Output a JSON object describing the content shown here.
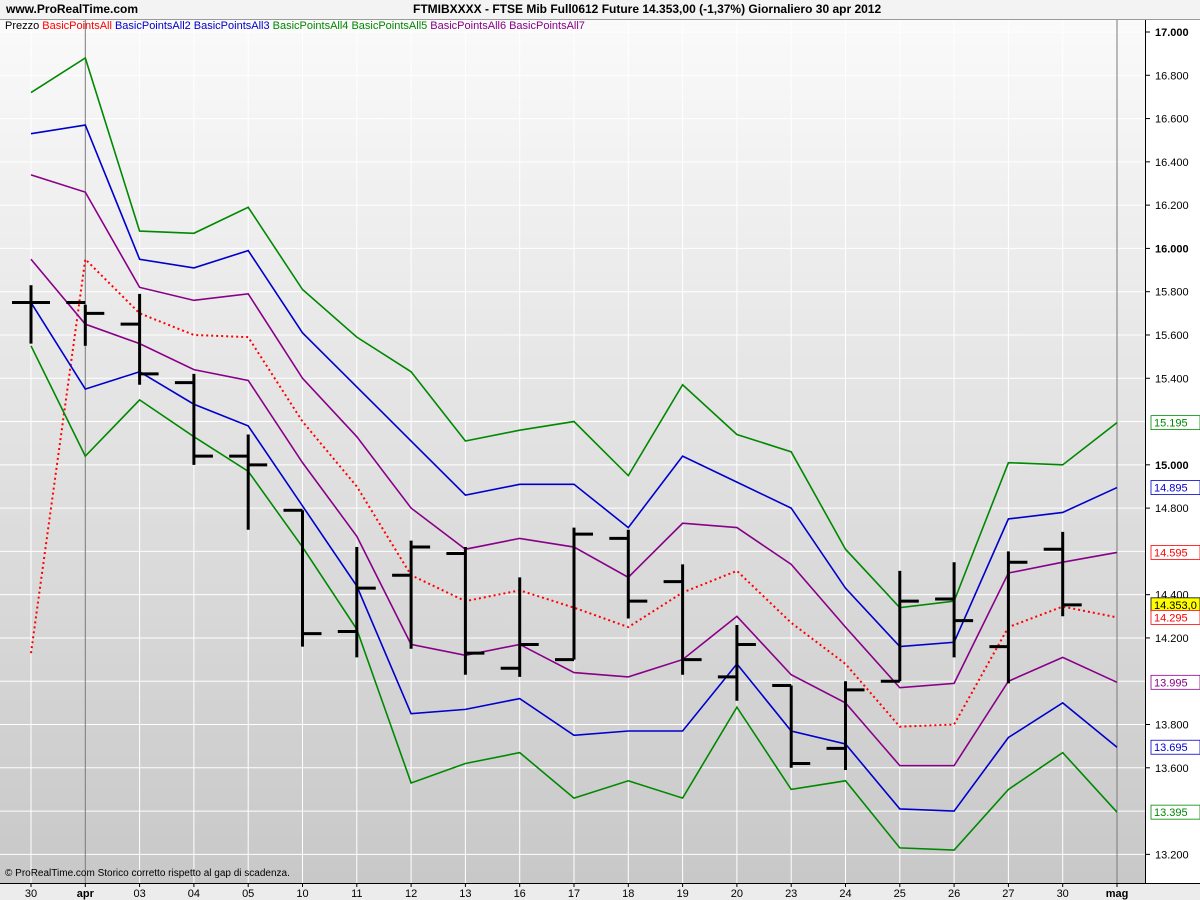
{
  "header": {
    "site": "www.ProRealTime.com",
    "title": "FTMIBXXXX - FTSE Mib Full0612 Future    14.353,00 (-1,37%)    Giornaliero  30 apr 2012"
  },
  "legend": [
    {
      "label": "Prezzo",
      "color": "#000000"
    },
    {
      "label": "BasicPointsAll",
      "color": "#ff0000"
    },
    {
      "label": "BasicPointsAll2",
      "color": "#0000cc"
    },
    {
      "label": "BasicPointsAll3",
      "color": "#0000cc"
    },
    {
      "label": "BasicPointsAll4",
      "color": "#008800"
    },
    {
      "label": "BasicPointsAll5",
      "color": "#008800"
    },
    {
      "label": "BasicPointsAll6",
      "color": "#880088"
    },
    {
      "label": "BasicPointsAll7",
      "color": "#880088"
    }
  ],
  "footer": "© ProRealTime.com  Storico corretto rispetto al gap di scadenza.",
  "chart_data": {
    "type": "line",
    "categories": [
      "30",
      "apr",
      "03",
      "04",
      "05",
      "10",
      "11",
      "12",
      "13",
      "16",
      "17",
      "18",
      "19",
      "20",
      "23",
      "24",
      "25",
      "26",
      "27",
      "30",
      "mag"
    ],
    "ylim": [
      13100,
      17000
    ],
    "yticks": [
      {
        "v": 17000,
        "label": "17.000",
        "bold": true
      },
      {
        "v": 16800,
        "label": "16.800",
        "bold": false
      },
      {
        "v": 16600,
        "label": "16.600",
        "bold": false
      },
      {
        "v": 16400,
        "label": "16.400",
        "bold": false
      },
      {
        "v": 16200,
        "label": "16.200",
        "bold": false
      },
      {
        "v": 16000,
        "label": "16.000",
        "bold": true
      },
      {
        "v": 15800,
        "label": "15.800",
        "bold": false
      },
      {
        "v": 15600,
        "label": "15.600",
        "bold": false
      },
      {
        "v": 15400,
        "label": "15.400",
        "bold": false
      },
      {
        "v": 15000,
        "label": "15.000",
        "bold": true
      },
      {
        "v": 14800,
        "label": "14.800",
        "bold": false
      },
      {
        "v": 14400,
        "label": "14.400",
        "bold": false
      },
      {
        "v": 14200,
        "label": "14.200",
        "bold": false
      },
      {
        "v": 13800,
        "label": "13.800",
        "bold": false
      },
      {
        "v": 13600,
        "label": "13.600",
        "bold": false
      },
      {
        "v": 13200,
        "label": "13.200",
        "bold": false
      }
    ],
    "value_labels": [
      {
        "v": 15195,
        "label": "15.195",
        "color": "#008800",
        "bg": "#ffffff"
      },
      {
        "v": 14895,
        "label": "14.895",
        "color": "#0000cc",
        "bg": "#ffffff"
      },
      {
        "v": 14595,
        "label": "14.595",
        "color": "#ff0000",
        "bg": "#ffffff"
      },
      {
        "v": 14353,
        "label": "14.353,0",
        "color": "#000000",
        "bg": "#ffff00"
      },
      {
        "v": 14295,
        "label": "14.295",
        "color": "#ff0000",
        "bg": "#ffffff"
      },
      {
        "v": 13995,
        "label": "13.995",
        "color": "#880088",
        "bg": "#ffffff"
      },
      {
        "v": 13695,
        "label": "13.695",
        "color": "#0000cc",
        "bg": "#ffffff"
      },
      {
        "v": 13395,
        "label": "13.395",
        "color": "#008800",
        "bg": "#ffffff"
      }
    ],
    "ohlc": [
      {
        "x": "30",
        "open": 15750,
        "high": 15830,
        "low": 15560,
        "close": 15750
      },
      {
        "x": "apr",
        "open": 15750,
        "high": 15740,
        "low": 15550,
        "close": 15700
      },
      {
        "x": "03",
        "open": 15650,
        "high": 15790,
        "low": 15370,
        "close": 15420
      },
      {
        "x": "04",
        "open": 15380,
        "high": 15420,
        "low": 15000,
        "close": 15040
      },
      {
        "x": "05",
        "open": 15040,
        "high": 15140,
        "low": 14700,
        "close": 15000
      },
      {
        "x": "10",
        "open": 14790,
        "high": 14790,
        "low": 14160,
        "close": 14220
      },
      {
        "x": "11",
        "open": 14230,
        "high": 14620,
        "low": 14110,
        "close": 14430
      },
      {
        "x": "12",
        "open": 14490,
        "high": 14650,
        "low": 14150,
        "close": 14620
      },
      {
        "x": "13",
        "open": 14590,
        "high": 14620,
        "low": 14030,
        "close": 14130
      },
      {
        "x": "16",
        "open": 14060,
        "high": 14480,
        "low": 14020,
        "close": 14170
      },
      {
        "x": "17",
        "open": 14100,
        "high": 14710,
        "low": 14100,
        "close": 14680
      },
      {
        "x": "18",
        "open": 14660,
        "high": 14700,
        "low": 14290,
        "close": 14370
      },
      {
        "x": "19",
        "open": 14460,
        "high": 14540,
        "low": 14030,
        "close": 14100
      },
      {
        "x": "20",
        "open": 14020,
        "high": 14260,
        "low": 13910,
        "close": 14170
      },
      {
        "x": "23",
        "open": 13980,
        "high": 13980,
        "low": 13600,
        "close": 13620
      },
      {
        "x": "24",
        "open": 13690,
        "high": 14000,
        "low": 13590,
        "close": 13960
      },
      {
        "x": "25",
        "open": 14000,
        "high": 14510,
        "low": 14000,
        "close": 14370
      },
      {
        "x": "26",
        "open": 14380,
        "high": 14550,
        "low": 14110,
        "close": 14280
      },
      {
        "x": "27",
        "open": 14160,
        "high": 14600,
        "low": 13990,
        "close": 14550
      },
      {
        "x": "30",
        "open": 14610,
        "high": 14690,
        "low": 14300,
        "close": 14353
      }
    ],
    "series": [
      {
        "name": "BasicPointsAll",
        "color": "#ff0000",
        "dashed": true,
        "values": [
          14130,
          15950,
          15700,
          15600,
          15590,
          15200,
          14900,
          14490,
          14370,
          14420,
          14340,
          14250,
          14410,
          14510,
          14270,
          14080,
          13790,
          13800,
          14250,
          14345,
          14295
        ]
      },
      {
        "name": "BasicPointsAll2",
        "color": "#0000cc",
        "dashed": false,
        "values": [
          16530,
          16570,
          15950,
          15910,
          15990,
          15610,
          15360,
          15110,
          14860,
          14910,
          14910,
          14710,
          15040,
          14920,
          14800,
          14430,
          14160,
          14180,
          14750,
          14780,
          14895
        ]
      },
      {
        "name": "BasicPointsAll3",
        "color": "#0000cc",
        "dashed": false,
        "values": [
          15750,
          15350,
          15430,
          15280,
          15180,
          14810,
          14440,
          13850,
          13870,
          13920,
          13750,
          13770,
          13770,
          14080,
          13770,
          13710,
          13410,
          13400,
          13740,
          13900,
          13695
        ]
      },
      {
        "name": "BasicPointsAll4",
        "color": "#008800",
        "dashed": false,
        "values": [
          16720,
          16880,
          16080,
          16070,
          16190,
          15810,
          15590,
          15430,
          15110,
          15160,
          15200,
          14950,
          15370,
          15140,
          15060,
          14610,
          14340,
          14370,
          15010,
          15000,
          15195
        ]
      },
      {
        "name": "BasicPointsAll5",
        "color": "#008800",
        "dashed": false,
        "values": [
          15550,
          15040,
          15300,
          15130,
          14970,
          14620,
          14240,
          13530,
          13620,
          13670,
          13460,
          13540,
          13460,
          13880,
          13500,
          13540,
          13230,
          13220,
          13500,
          13670,
          13395
        ]
      },
      {
        "name": "BasicPointsAll6",
        "color": "#880088",
        "dashed": false,
        "values": [
          16340,
          16260,
          15820,
          15760,
          15790,
          15400,
          15130,
          14800,
          14610,
          14660,
          14620,
          14480,
          14730,
          14710,
          14540,
          14250,
          13970,
          13990,
          14500,
          14550,
          14595
        ]
      },
      {
        "name": "BasicPointsAll7",
        "color": "#880088",
        "dashed": false,
        "values": [
          15950,
          15650,
          15560,
          15440,
          15390,
          15010,
          14670,
          14170,
          14120,
          14170,
          14040,
          14020,
          14100,
          14300,
          14030,
          13900,
          13610,
          13610,
          14000,
          14110,
          13995
        ]
      }
    ]
  }
}
